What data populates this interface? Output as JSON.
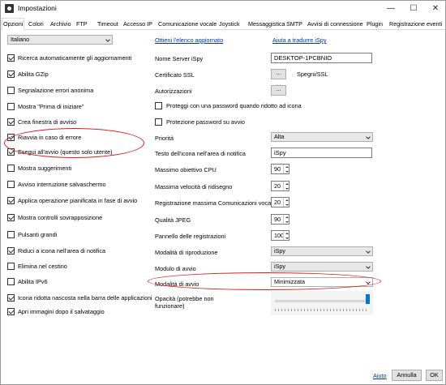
{
  "window": {
    "title": "Impostazioni"
  },
  "titlebar": {
    "minimize": "—",
    "maximize": "☐",
    "close": "✕"
  },
  "tabs": [
    "Opzioni",
    "Colori",
    "Archivio",
    "FTP",
    "Timeout",
    "Accesso IP",
    "Comunicazione vocale",
    "Joystick",
    "Messaggistica",
    "SMTP",
    "Avvisi di connessione",
    "Plugin",
    "Registrazione eventi"
  ],
  "left": {
    "language": "Italiano",
    "checkboxes": [
      {
        "label": "Ricerca automaticamente gli aggiornamenti",
        "checked": true
      },
      {
        "label": "Abilita GZip",
        "checked": true
      },
      {
        "label": "Segnalazione errori anonima",
        "checked": false
      },
      {
        "label": "Mostra \"Prima di iniziare\"",
        "checked": false
      },
      {
        "label": "Crea finestra di avviso",
        "checked": true
      },
      {
        "label": "Riavvia in caso di errore",
        "checked": true
      },
      {
        "label": "Esegui all'avvio (questo solo utente)",
        "checked": true
      },
      {
        "label": "Mostra suggerimenti",
        "checked": false
      },
      {
        "label": "Avviso interruzione salvaschermo",
        "checked": false
      },
      {
        "label": "Applica operazione pianificata in fase di avvio",
        "checked": true
      },
      {
        "label": "Mostra controlli sovrapposizione",
        "checked": true
      },
      {
        "label": "Pulsanti grandi",
        "checked": false
      },
      {
        "label": "Riduci a icona nell'area di notifica",
        "checked": true
      },
      {
        "label": "Elimina nel cestino",
        "checked": false
      },
      {
        "label": "Abilita IPv6",
        "checked": false
      },
      {
        "label": "Icona ridotta nascosta nella barra delle applicazioni",
        "checked": true
      },
      {
        "label": "Apri immagini dopo il salvataggio",
        "checked": true
      }
    ]
  },
  "right": {
    "links": {
      "get_list": "Ottieni l'elenco aggiornato",
      "help_translate": "Aiuta a tradurre iSpy"
    },
    "server_name_label": "Nome Server iSpy",
    "server_name_value": "DESKTOP-1PCBNIO",
    "ssl_label": "Certificato SSL",
    "ssl_btn": "...",
    "ssl_status": "Spegni/SSL",
    "auth_label": "Autorizzazioni",
    "auth_btn": "...",
    "protect_minimized": {
      "label": "Proteggi con una password quando ridotto ad icona",
      "checked": false
    },
    "protect_startup": {
      "label": "Protezione password su avvio",
      "checked": false
    },
    "priority_label": "Priorità",
    "priority_value": "Alta",
    "tray_text_label": "Testo dell'icona nell'area di notifica",
    "tray_text_value": "iSpy",
    "cpu_label": "Massimo obiettivo CPU",
    "cpu_value": "90",
    "redraw_label": "Massima velocità di ridisegno",
    "redraw_value": "20",
    "voice_label": "Registrazione massima Comunicazioni vocali",
    "voice_value": "20",
    "jpeg_label": "Qualità JPEG",
    "jpeg_value": "90",
    "recordings_label": "Pannello delle registrazioni",
    "recordings_value": "100",
    "playback_label": "Modalità di riproduzione",
    "playback_value": "iSpy",
    "startup_form_label": "Modulo di avvio",
    "startup_form_value": "iSpy",
    "startup_mode_label": "Modalità di avvio",
    "startup_mode_value": "Minimizzata",
    "opacity_label": "Opacità (potrebbe non funzionare)",
    "opacity_fraction": 1.0
  },
  "footer": {
    "help": "Aiuto",
    "cancel": "Annulla",
    "ok": "OK"
  },
  "colors": {
    "highlight": "#e01b1b",
    "link": "#0033cc",
    "slider": "#0078d7"
  }
}
